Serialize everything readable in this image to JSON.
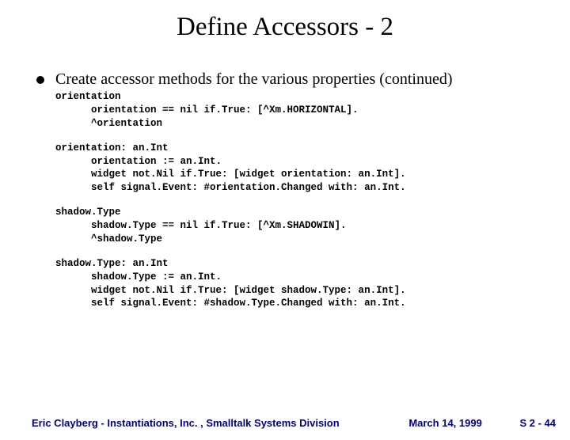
{
  "title": "Define Accessors - 2",
  "bullet_text": "Create accessor methods for the various properties (continued)",
  "code1": "orientation\n      orientation == nil if.True: [^Xm.HORIZONTAL].\n      ^orientation",
  "code2": "orientation: an.Int\n      orientation := an.Int.\n      widget not.Nil if.True: [widget orientation: an.Int].\n      self signal.Event: #orientation.Changed with: an.Int.",
  "code3": "shadow.Type\n      shadow.Type == nil if.True: [^Xm.SHADOWIN].\n      ^shadow.Type",
  "code4": "shadow.Type: an.Int\n      shadow.Type := an.Int.\n      widget not.Nil if.True: [widget shadow.Type: an.Int].\n      self signal.Event: #shadow.Type.Changed with: an.Int.",
  "footer": {
    "author": "Eric Clayberg - Instantiations, Inc. , Smalltalk Systems Division",
    "date": "March 14, 1999",
    "page": "S 2 - 44"
  }
}
